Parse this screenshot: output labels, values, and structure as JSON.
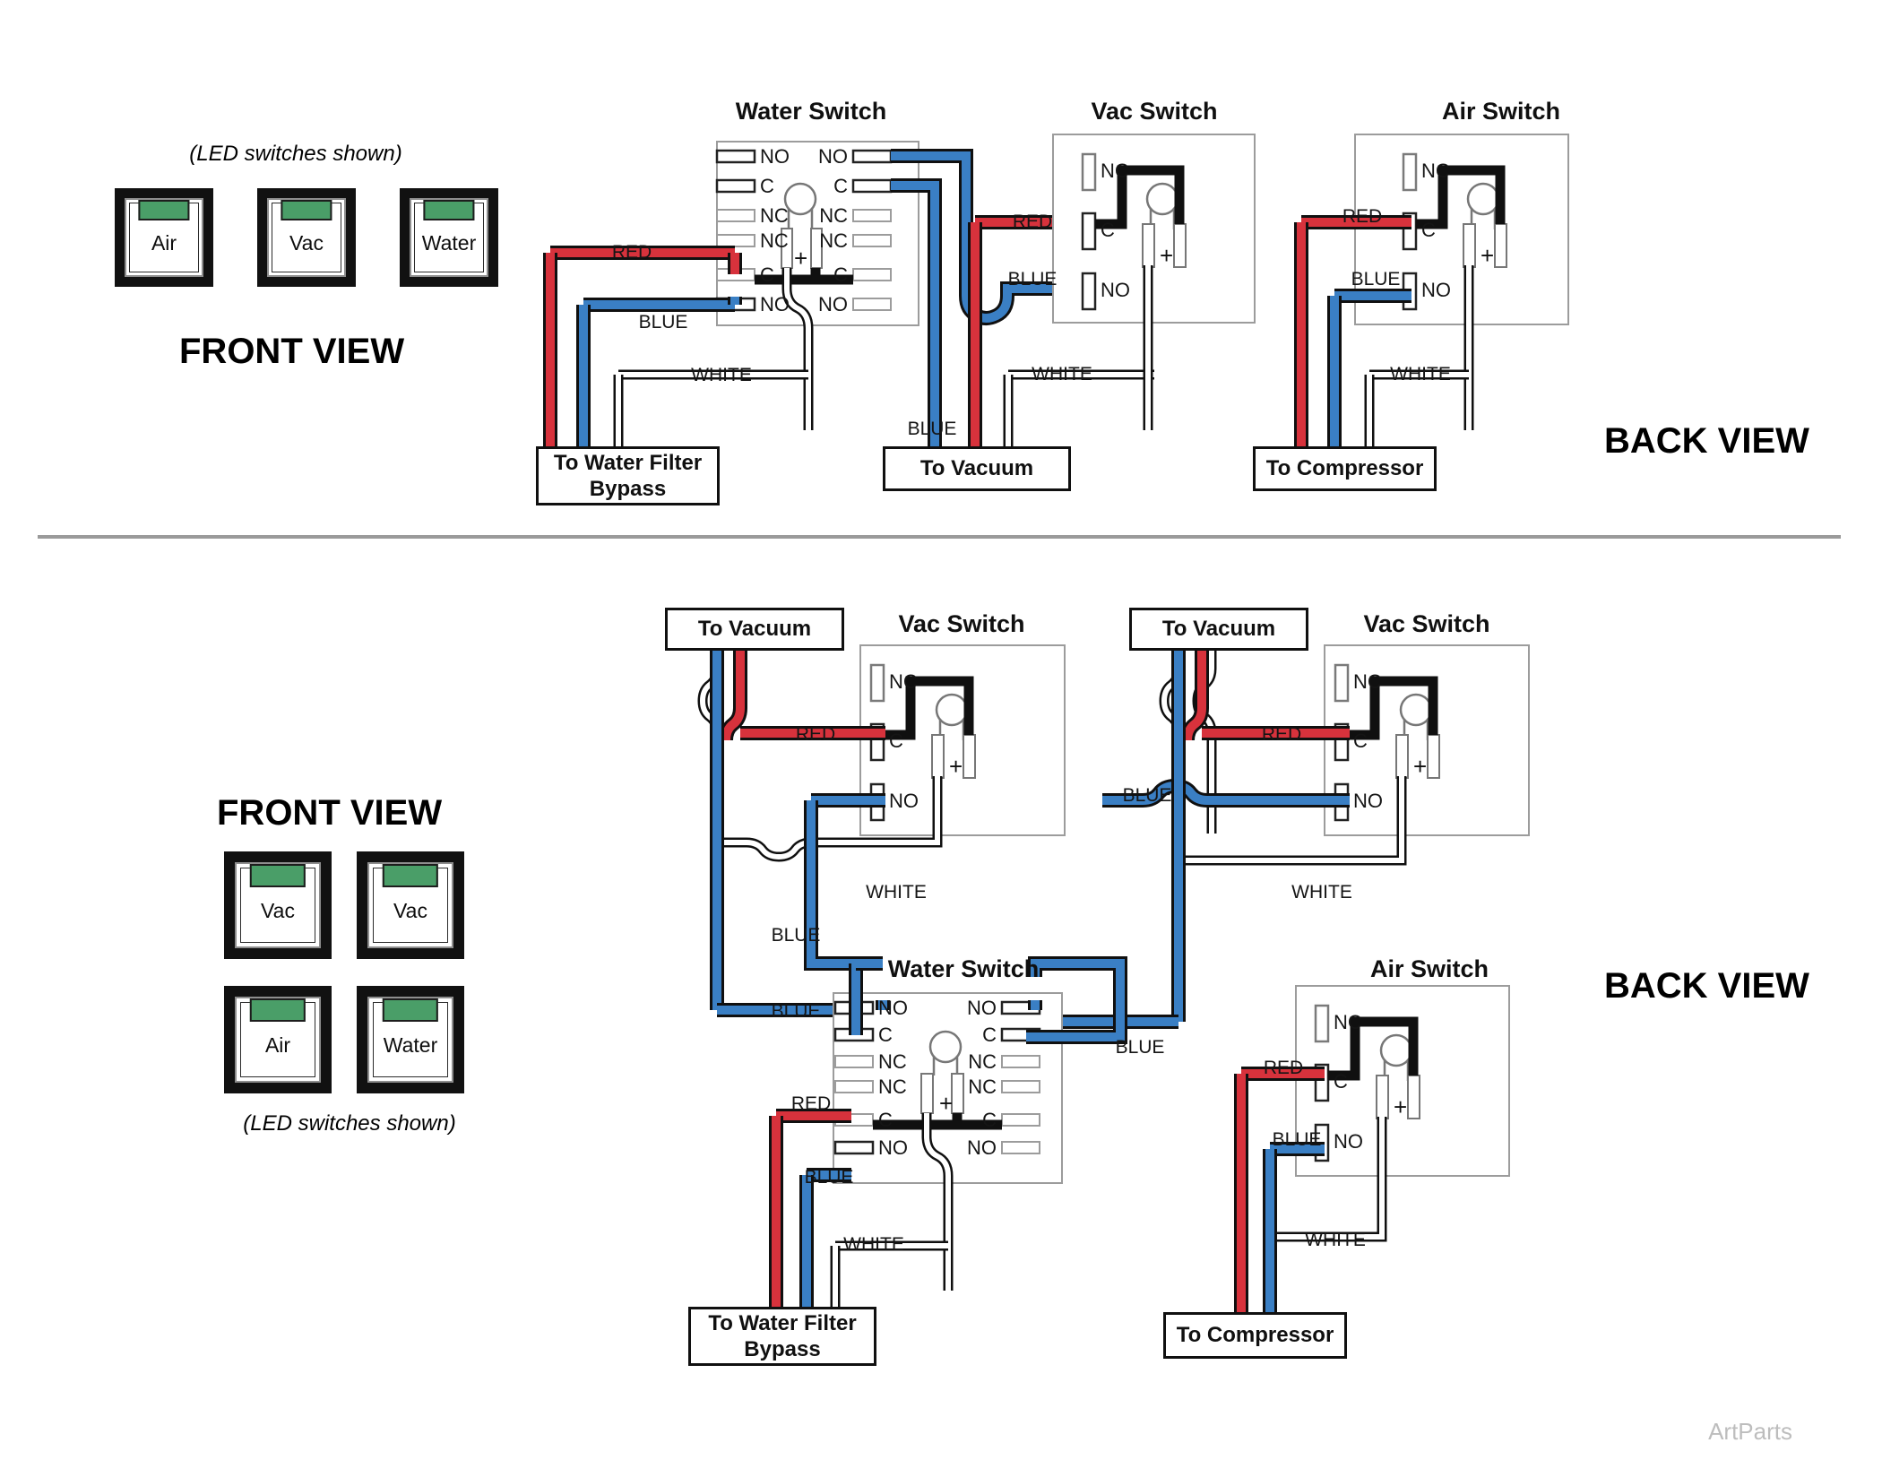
{
  "meta": {
    "watermark": "ArtParts",
    "colors": {
      "red": "#d7323c",
      "blue": "#3a7fc4",
      "white_wire": "#ffffff",
      "black_wire": "#101010",
      "led_green": "#4a9e68",
      "switch_body": "#111111",
      "divider": "#9a9a9a"
    }
  },
  "panel_top": {
    "front_view": {
      "title": "FRONT VIEW",
      "note": "(LED switches shown)",
      "switches": [
        {
          "label": "Air"
        },
        {
          "label": "Vac"
        },
        {
          "label": "Water"
        }
      ]
    },
    "back_view": {
      "title": "BACK VIEW"
    },
    "switches": [
      {
        "name": "water-switch",
        "title": "Water Switch",
        "type": "double",
        "terminals_left": [
          "NO",
          "C",
          "NC",
          "NC",
          "C",
          "NO"
        ],
        "terminals_right": [
          "NO",
          "C",
          "NC",
          "NC",
          "C",
          "NO"
        ],
        "lamp_plus": "+"
      },
      {
        "name": "vac-switch",
        "title": "Vac Switch",
        "type": "single",
        "terminals": [
          "NC",
          "C",
          "NO"
        ],
        "lamp_plus": "+"
      },
      {
        "name": "air-switch",
        "title": "Air Switch",
        "type": "single",
        "terminals": [
          "NC",
          "C",
          "NO"
        ],
        "lamp_plus": "+"
      }
    ],
    "wire_labels": [
      "RED",
      "BLUE",
      "WHITE",
      "RED",
      "BLUE",
      "WHITE",
      "BLUE",
      "RED",
      "BLUE",
      "WHITE"
    ],
    "destinations": [
      {
        "label": "To Water Filter Bypass"
      },
      {
        "label": "To Vacuum"
      },
      {
        "label": "To Compressor"
      }
    ]
  },
  "panel_bottom": {
    "front_view": {
      "title": "FRONT VIEW",
      "note": "(LED switches shown)",
      "switches": [
        {
          "label": "Vac"
        },
        {
          "label": "Vac"
        },
        {
          "label": "Air"
        },
        {
          "label": "Water"
        }
      ]
    },
    "back_view": {
      "title": "BACK VIEW"
    },
    "switches": [
      {
        "name": "vac-switch-left",
        "title": "Vac Switch",
        "type": "single",
        "terminals": [
          "NC",
          "C",
          "NO"
        ],
        "lamp_plus": "+"
      },
      {
        "name": "vac-switch-right",
        "title": "Vac Switch",
        "type": "single",
        "terminals": [
          "NC",
          "C",
          "NO"
        ],
        "lamp_plus": "+"
      },
      {
        "name": "water-switch",
        "title": "Water Switch",
        "type": "double",
        "terminals_left": [
          "NO",
          "C",
          "NC",
          "NC",
          "C",
          "NO"
        ],
        "terminals_right": [
          "NO",
          "C",
          "NC",
          "NC",
          "C",
          "NO"
        ],
        "lamp_plus": "+"
      },
      {
        "name": "air-switch",
        "title": "Air Switch",
        "type": "single",
        "terminals": [
          "NC",
          "C",
          "NO"
        ],
        "lamp_plus": "+"
      }
    ],
    "wire_labels": [
      "RED",
      "WHITE",
      "BLUE",
      "BLUE",
      "RED",
      "BLUE",
      "WHITE",
      "BLUE",
      "RED",
      "BLUE",
      "WHITE",
      "RED",
      "BLUE",
      "WHITE"
    ],
    "destinations": [
      {
        "label": "To Vacuum"
      },
      {
        "label": "To Vacuum"
      },
      {
        "label": "To Water Filter Bypass"
      },
      {
        "label": "To Compressor"
      }
    ]
  }
}
